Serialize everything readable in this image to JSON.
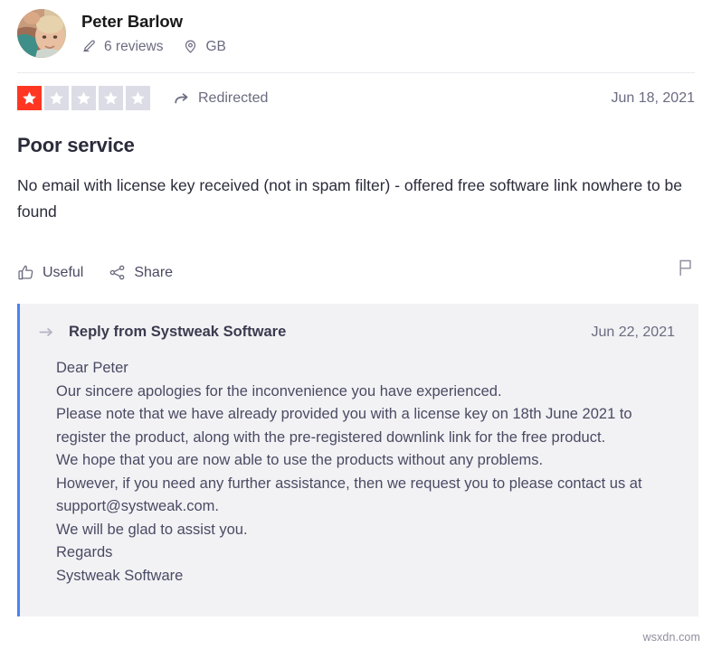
{
  "consumer": {
    "name": "Peter Barlow",
    "reviews_count_label": "6 reviews",
    "location_label": "GB",
    "reviews_icon": "pencil-icon",
    "location_icon": "map-pin-icon",
    "avatar_alt": "user-avatar-photo"
  },
  "rating": {
    "value": 1,
    "max": 5,
    "filled_color": "#ff3722",
    "empty_color": "#dcdce6",
    "star_glyph_color": "#ffffff",
    "redirected_label": "Redirected",
    "redirected_icon": "redirect-arrow-icon"
  },
  "review": {
    "date": "Jun 18, 2021",
    "title": "Poor service",
    "body": "No email with license key received (not in spam filter) - offered free software link nowhere to be found"
  },
  "actions": {
    "useful_label": "Useful",
    "useful_icon": "thumbs-up-icon",
    "share_label": "Share",
    "share_icon": "share-nodes-icon",
    "report_icon": "flag-icon"
  },
  "reply": {
    "header_icon": "reply-arrow-icon",
    "title": "Reply from Systweak Software",
    "date": "Jun 22, 2021",
    "accent_color": "#4d82f3",
    "background_color": "#f2f2f5",
    "lines": [
      "Dear Peter",
      "Our sincere apologies for the inconvenience you have experienced.",
      "Please note that we have already provided you with a license key on 18th June 2021 to register the product, along with the pre-registered downlink link for the free product.",
      "We hope that you are now able to use the products without any problems.",
      "However, if you need any further assistance, then we request you to please contact us at support@systweak.com.",
      "We will be glad to assist you.",
      "Regards",
      "Systweak Software"
    ]
  },
  "watermark": {
    "text": "wsxdn.com"
  }
}
